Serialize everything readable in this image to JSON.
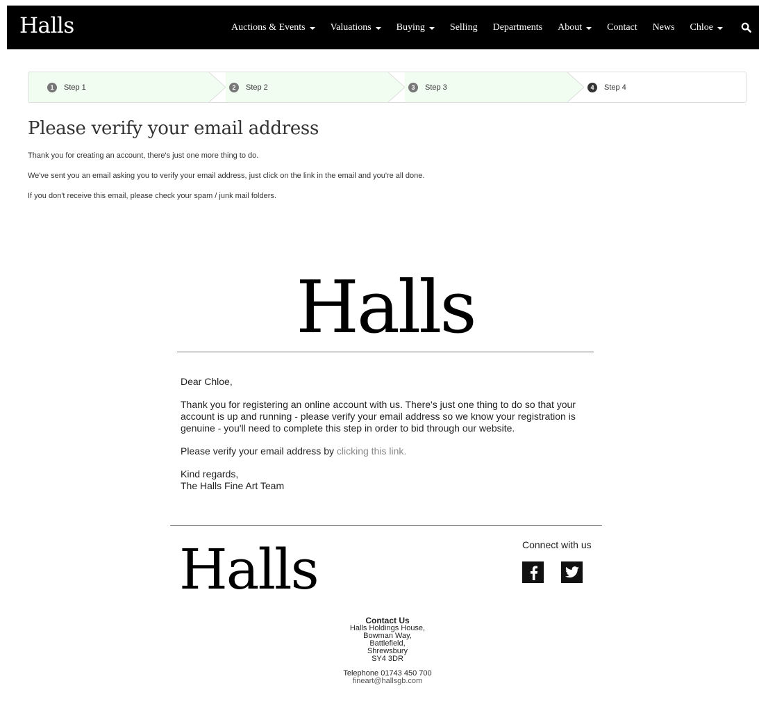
{
  "nav": {
    "brand": "Halls",
    "items": [
      {
        "label": "Auctions & Events",
        "dropdown": true
      },
      {
        "label": "Valuations",
        "dropdown": true
      },
      {
        "label": "Buying",
        "dropdown": true
      },
      {
        "label": "Selling",
        "dropdown": false
      },
      {
        "label": "Departments",
        "dropdown": false
      },
      {
        "label": "About",
        "dropdown": true
      },
      {
        "label": "Contact",
        "dropdown": false
      },
      {
        "label": "News",
        "dropdown": false
      },
      {
        "label": "Chloe",
        "dropdown": true
      }
    ],
    "search_icon": "search-icon"
  },
  "steps": [
    {
      "number": "1",
      "label": "Step 1",
      "status": "done"
    },
    {
      "number": "2",
      "label": "Step 2",
      "status": "done"
    },
    {
      "number": "3",
      "label": "Step 3",
      "status": "done"
    },
    {
      "number": "4",
      "label": "Step 4",
      "status": "active"
    }
  ],
  "main": {
    "title": "Please verify your email address",
    "paragraphs": [
      "Thank you for creating an account, there's just one more thing to do.",
      "We've sent you an email asking you to verify your email address, just click on the link in the email and you're all done.",
      "If you don't receive this email, please check your spam / junk mail folders."
    ]
  },
  "email": {
    "logo": "Halls",
    "greeting": "Dear Chloe,",
    "body": "Thank you for registering an online account with us. There's just one thing to do so that your account is up and running - please verify your email address so we know your registration is genuine - you'll need to complete this step in order to bid through our website.",
    "verify_prefix": "Please verify your email address by ",
    "verify_link": "clicking this link.",
    "signoff_1": "Kind regards,",
    "signoff_2": "The Halls Fine Art Team",
    "footer_logo": "Halls",
    "connect": "Connect with us",
    "social": [
      "facebook-icon",
      "twitter-icon"
    ],
    "contact": {
      "label": "Contact Us",
      "address": [
        "Halls Holdings House,",
        "Bowman Way,",
        "Battlefield,",
        "Shrewsbury",
        "SY4 3DR"
      ],
      "telephone": "Telephone 01743 450 700",
      "email": "fineart@hallsgb.com"
    }
  },
  "colors": {
    "nav_bg": "#000000",
    "step_done_bg": "#f1fdf1",
    "step_badge": "#777777",
    "step_badge_active": "#333333",
    "link": "#888888"
  }
}
